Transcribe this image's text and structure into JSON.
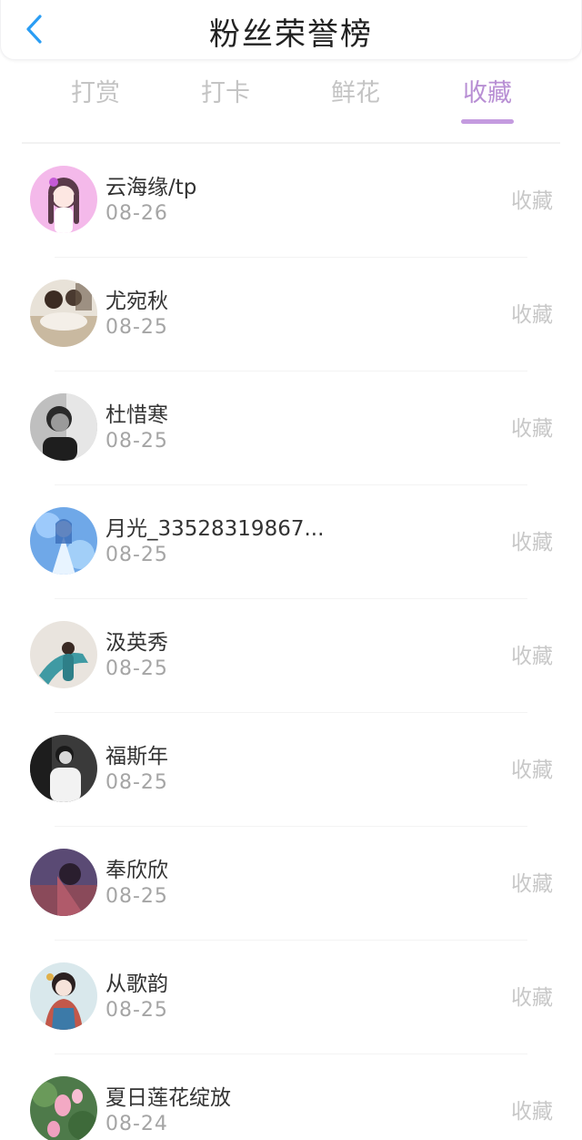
{
  "header": {
    "title": "粉丝荣誉榜"
  },
  "tabs": [
    {
      "label": "打赏",
      "active": false
    },
    {
      "label": "打卡",
      "active": false
    },
    {
      "label": "鲜花",
      "active": false
    },
    {
      "label": "收藏",
      "active": true
    }
  ],
  "colors": {
    "back_icon": "#2a9df4",
    "active_tab": "#b88fd4",
    "inactive_tab": "#c4c4c4"
  },
  "list": [
    {
      "name": "云海缘/tp",
      "date": "08-26",
      "action": "收藏",
      "avatar": "anime-girl-pink"
    },
    {
      "name": "尤宛秋",
      "date": "08-25",
      "action": "收藏",
      "avatar": "couple-illustration"
    },
    {
      "name": "杜惜寒",
      "date": "08-25",
      "action": "收藏",
      "avatar": "man-photo-bw"
    },
    {
      "name": "月光_33528319867...",
      "date": "08-25",
      "action": "收藏",
      "avatar": "blue-fantasy-girl"
    },
    {
      "name": "汲英秀",
      "date": "08-25",
      "action": "收藏",
      "avatar": "dancer-teal"
    },
    {
      "name": "福斯年",
      "date": "08-25",
      "action": "收藏",
      "avatar": "man-white-shirt-bw"
    },
    {
      "name": "奉欣欣",
      "date": "08-25",
      "action": "收藏",
      "avatar": "woman-dark-red"
    },
    {
      "name": "从歌韵",
      "date": "08-25",
      "action": "收藏",
      "avatar": "ancient-costume-girl"
    },
    {
      "name": "夏日莲花绽放",
      "date": "08-24",
      "action": "收藏",
      "avatar": "lotus-flowers"
    }
  ]
}
